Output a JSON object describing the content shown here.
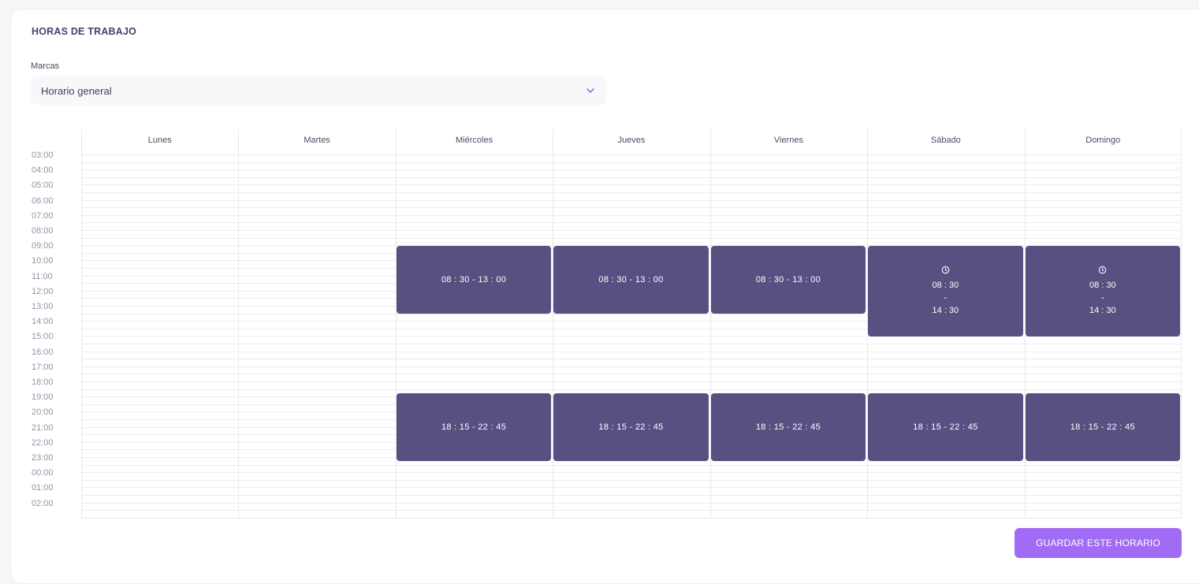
{
  "page": {
    "title": "HORAS DE TRABAJO"
  },
  "brand_select": {
    "label": "Marcas",
    "value": "Horario general",
    "icon": "chevron-down-icon",
    "accent": "#a26bf5"
  },
  "calendar": {
    "days": [
      "Lunes",
      "Martes",
      "Miércoles",
      "Jueves",
      "Viernes",
      "Sábado",
      "Domingo"
    ],
    "time_labels": [
      "03:00",
      "04:00",
      "05:00",
      "06:00",
      "07:00",
      "08:00",
      "09:00",
      "10:00",
      "11:00",
      "12:00",
      "13:00",
      "14:00",
      "15:00",
      "16:00",
      "17:00",
      "18:00",
      "19:00",
      "20:00",
      "21:00",
      "22:00",
      "23:00",
      "00:00",
      "01:00",
      "02:00"
    ],
    "event_color": "#565181",
    "events": [
      {
        "day": 2,
        "start": "08:30",
        "end": "13:00",
        "label": "08 : 30 - 13 : 00"
      },
      {
        "day": 3,
        "start": "08:30",
        "end": "13:00",
        "label": "08 : 30 - 13 : 00"
      },
      {
        "day": 4,
        "start": "08:30",
        "end": "13:00",
        "label": "08 : 30 - 13 : 00"
      },
      {
        "day": 5,
        "start": "08:30",
        "end": "14:30",
        "icon": "clock-icon",
        "start_label": "08 : 30",
        "separator": "-",
        "end_label": "14 : 30"
      },
      {
        "day": 6,
        "start": "08:30",
        "end": "14:30",
        "icon": "clock-icon",
        "start_label": "08 : 30",
        "separator": "-",
        "end_label": "14 : 30"
      },
      {
        "day": 2,
        "start": "18:15",
        "end": "22:45",
        "label": "18 : 15 - 22 : 45"
      },
      {
        "day": 3,
        "start": "18:15",
        "end": "22:45",
        "label": "18 : 15 - 22 : 45"
      },
      {
        "day": 4,
        "start": "18:15",
        "end": "22:45",
        "label": "18 : 15 - 22 : 45"
      },
      {
        "day": 5,
        "start": "18:15",
        "end": "22:45",
        "label": "18 : 15 - 22 : 45"
      },
      {
        "day": 6,
        "start": "18:15",
        "end": "22:45",
        "label": "18 : 15 - 22 : 45"
      }
    ]
  },
  "actions": {
    "save_label": "GUARDAR ESTE HORARIO",
    "save_color": "#a26bf5"
  }
}
